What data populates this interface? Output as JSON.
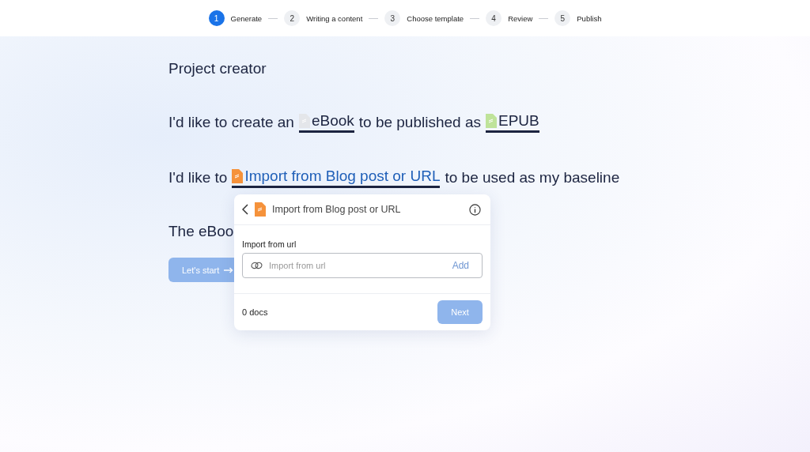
{
  "steps": [
    {
      "number": "1",
      "label": "Generate",
      "selected": true
    },
    {
      "number": "2",
      "label": "Writing a content",
      "selected": false
    },
    {
      "number": "3",
      "label": "Choose template",
      "selected": false
    },
    {
      "number": "4",
      "label": "Review",
      "selected": false
    },
    {
      "number": "5",
      "label": "Publish",
      "selected": false
    }
  ],
  "title": "Project creator",
  "sentence_1": {
    "prefix": "I'd like to create an",
    "choice_1": "eBook",
    "middle": "to be published as",
    "choice_2": "EPUB"
  },
  "sentence_2": {
    "prefix": "I'd like to",
    "choice": "Import from Blog post or URL",
    "choice_open": true,
    "suffix": "to be used as my baseline"
  },
  "sentence_3": {
    "prefix": "The eBoo"
  },
  "start_button": {
    "label": "Let's start",
    "disabled": true
  },
  "popover": {
    "title": "Import from Blog post or URL",
    "field_label": "Import from url",
    "placeholder": "Import from url",
    "add_label": "Add",
    "count": "0 docs",
    "next_label": "Next",
    "next_disabled": true
  }
}
